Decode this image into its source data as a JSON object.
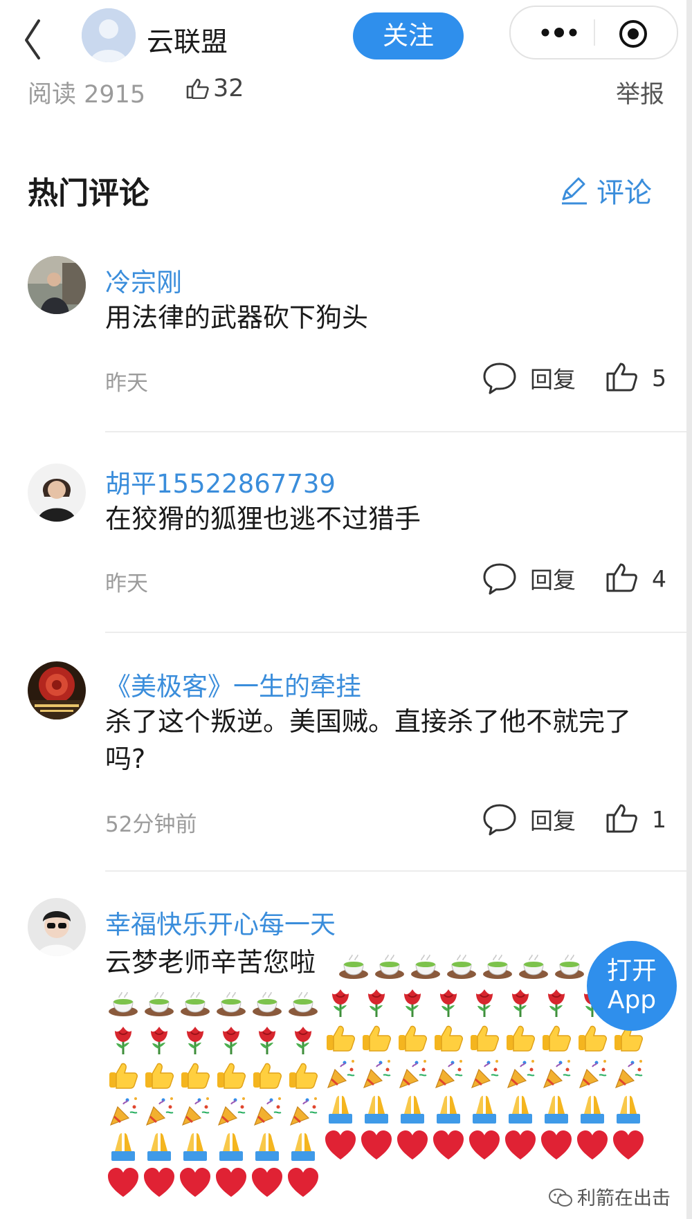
{
  "header": {
    "account_name": "云联盟",
    "follow_label": "关注"
  },
  "stats": {
    "read_label": "阅读 2915",
    "like_count": "32",
    "report_label": "举报"
  },
  "section": {
    "title": "热门评论",
    "comment_button": "评论"
  },
  "comments": [
    {
      "name": "冷宗刚",
      "text": "用法律的武器砍下狗头",
      "time": "昨天",
      "reply_label": "回复",
      "likes": "5"
    },
    {
      "name": "胡平15522867739",
      "text": "在狡猾的狐狸也逃不过猎手",
      "time": "昨天",
      "reply_label": "回复",
      "likes": "4"
    },
    {
      "name": "《美极客》一生的牵挂",
      "text": "杀了这个叛逆。美国贼。直接杀了他不就完了吗?",
      "time": "52分钟前",
      "reply_label": "回复",
      "likes": "1"
    },
    {
      "name": "幸福快乐开心每一天",
      "text": "云梦老师辛苦您啦"
    }
  ],
  "open_app": {
    "line1": "打开",
    "line2": "App"
  },
  "watermark": "利箭在出击",
  "colors": {
    "accent": "#2f8fec",
    "link": "#3a8ddb"
  },
  "icons": [
    "back-icon",
    "more-dots-icon",
    "target-icon",
    "thumbs-up-icon",
    "pencil-icon",
    "speech-bubble-icon",
    "wechat-icon"
  ],
  "emoji_rows": {
    "left": [
      "tea",
      "rose",
      "thumbs",
      "party",
      "pray",
      "heart"
    ],
    "right": [
      "rose",
      "thumbs",
      "party",
      "pray",
      "heart"
    ],
    "inline_count": 7,
    "left_count": 6,
    "right_count": 9
  }
}
